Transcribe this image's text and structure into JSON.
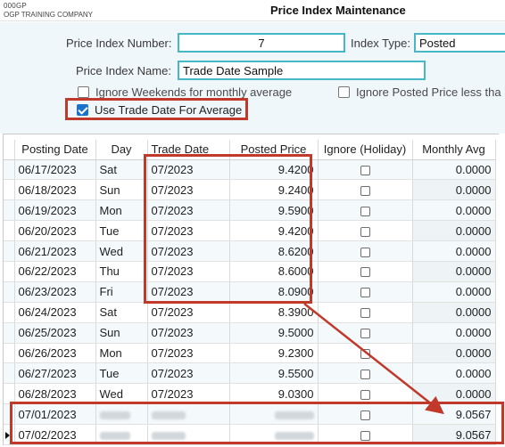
{
  "header": {
    "company_code": "000GP",
    "company_name": "OGP TRAINING COMPANY",
    "title": "Price Index Maintenance"
  },
  "form": {
    "price_index_number_label": "Price Index Number:",
    "price_index_number_value": "7",
    "index_type_label": "Index Type:",
    "index_type_value": "Posted",
    "price_index_name_label": "Price Index Name:",
    "price_index_name_value": "Trade Date Sample",
    "ignore_weekends_label": "Ignore Weekends for monthly average",
    "ignore_weekends_checked": false,
    "ignore_posted_label": "Ignore Posted Price less tha",
    "ignore_posted_checked": false,
    "use_trade_date_label": "Use Trade Date For Average",
    "use_trade_date_checked": true
  },
  "grid": {
    "columns": [
      "Posting Date",
      "Day",
      "Trade Date",
      "Posted Price",
      "Ignore (Holiday)",
      "Monthly Avg"
    ],
    "rows": [
      {
        "posting_date": "06/17/2023",
        "day": "Sat",
        "trade_date": "07/2023",
        "posted_price": "9.4200",
        "ignore": false,
        "monthly_avg": "0.0000"
      },
      {
        "posting_date": "06/18/2023",
        "day": "Sun",
        "trade_date": "07/2023",
        "posted_price": "9.2400",
        "ignore": false,
        "monthly_avg": "0.0000"
      },
      {
        "posting_date": "06/19/2023",
        "day": "Mon",
        "trade_date": "07/2023",
        "posted_price": "9.5900",
        "ignore": false,
        "monthly_avg": "0.0000"
      },
      {
        "posting_date": "06/20/2023",
        "day": "Tue",
        "trade_date": "07/2023",
        "posted_price": "9.4200",
        "ignore": false,
        "monthly_avg": "0.0000"
      },
      {
        "posting_date": "06/21/2023",
        "day": "Wed",
        "trade_date": "07/2023",
        "posted_price": "8.6200",
        "ignore": false,
        "monthly_avg": "0.0000"
      },
      {
        "posting_date": "06/22/2023",
        "day": "Thu",
        "trade_date": "07/2023",
        "posted_price": "8.6000",
        "ignore": false,
        "monthly_avg": "0.0000"
      },
      {
        "posting_date": "06/23/2023",
        "day": "Fri",
        "trade_date": "07/2023",
        "posted_price": "8.0900",
        "ignore": false,
        "monthly_avg": "0.0000"
      },
      {
        "posting_date": "06/24/2023",
        "day": "Sat",
        "trade_date": "07/2023",
        "posted_price": "8.3900",
        "ignore": false,
        "monthly_avg": "0.0000"
      },
      {
        "posting_date": "06/25/2023",
        "day": "Sun",
        "trade_date": "07/2023",
        "posted_price": "9.5000",
        "ignore": false,
        "monthly_avg": "0.0000"
      },
      {
        "posting_date": "06/26/2023",
        "day": "Mon",
        "trade_date": "07/2023",
        "posted_price": "9.2300",
        "ignore": false,
        "monthly_avg": "0.0000"
      },
      {
        "posting_date": "06/27/2023",
        "day": "Tue",
        "trade_date": "07/2023",
        "posted_price": "9.5500",
        "ignore": false,
        "monthly_avg": "0.0000"
      },
      {
        "posting_date": "06/28/2023",
        "day": "Wed",
        "trade_date": "07/2023",
        "posted_price": "9.0300",
        "ignore": false,
        "monthly_avg": "0.0000"
      },
      {
        "posting_date": "07/01/2023",
        "day": "",
        "trade_date": "",
        "posted_price": "",
        "ignore": false,
        "monthly_avg": "9.0567",
        "blurred": true
      },
      {
        "posting_date": "07/02/2023",
        "day": "",
        "trade_date": "",
        "posted_price": "",
        "ignore": false,
        "monthly_avg": "9.0567",
        "blurred": true,
        "selected": true
      }
    ]
  },
  "colors": {
    "accent_input_border": "#45b7c7",
    "annotation_red": "#c0392b",
    "checkbox_checked": "#1a73c8"
  }
}
